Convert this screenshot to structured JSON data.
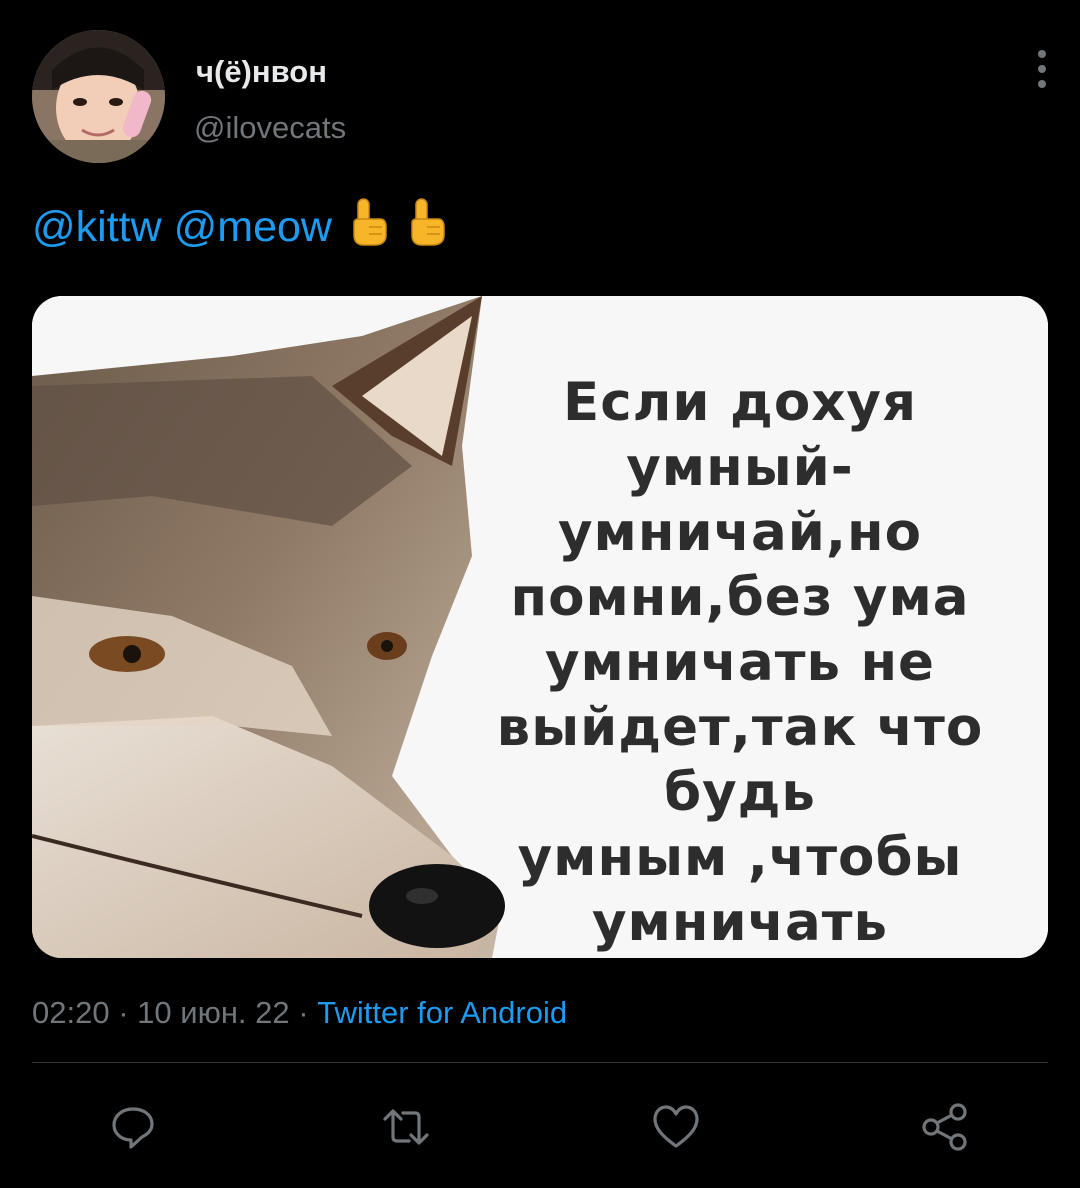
{
  "user": {
    "display_name": "ч(ё)нвон",
    "handle": "@ilovecats"
  },
  "tweet": {
    "mention_1": "@kittw",
    "mention_2": "@meow",
    "emojis": [
      "☝️",
      "☝️"
    ]
  },
  "media": {
    "meme_lines": [
      "Если дохуя",
      "умный-",
      "умничай,но",
      "помни,без ума",
      "умничать не",
      "выйдет,так что",
      "будь",
      "умным ,чтобы",
      "умничать"
    ]
  },
  "meta": {
    "time": "02:20",
    "separator": "·",
    "date": "10 июн. 22",
    "source": "Twitter for Android"
  },
  "actions": {
    "icons": [
      "reply-icon",
      "retweet-icon",
      "like-icon",
      "share-icon"
    ]
  },
  "colors": {
    "background": "#000000",
    "accent": "#1d9bf0",
    "muted": "#71767b",
    "text": "#e7e9ea"
  }
}
